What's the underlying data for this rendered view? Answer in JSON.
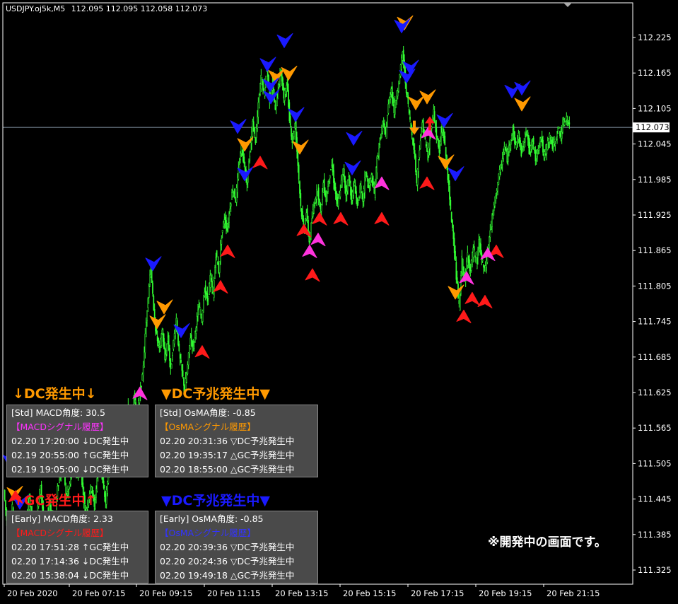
{
  "chart_data": {
    "type": "candlestick",
    "title": "USDJPY.oj5k,M5  112.095 112.095 112.058 112.073",
    "symbol": "USDJPY.oj5k,M5",
    "ohlc_header": "112.095 112.095 112.058 112.073",
    "last_price": "112.073",
    "ylim": [
      111.29,
      112.27
    ],
    "y_ticks": [
      "112.225",
      "112.165",
      "112.105",
      "112.045",
      "111.985",
      "111.925",
      "111.865",
      "111.805",
      "111.745",
      "111.685",
      "111.625",
      "111.565",
      "111.505",
      "111.445",
      "111.385",
      "111.325"
    ],
    "x_ticks": [
      "20 Feb 2020",
      "20 Feb 07:15",
      "20 Feb 09:15",
      "20 Feb 11:15",
      "20 Feb 13:15",
      "20 Feb 15:15",
      "20 Feb 17:15",
      "20 Feb 19:15",
      "20 Feb 21:15"
    ],
    "close_path": [
      [
        0,
        111.46
      ],
      [
        4,
        111.41
      ],
      [
        8,
        111.38
      ],
      [
        12,
        111.43
      ],
      [
        16,
        111.4
      ],
      [
        20,
        111.37
      ],
      [
        24,
        111.36
      ],
      [
        28,
        111.42
      ],
      [
        32,
        111.4
      ],
      [
        36,
        111.45
      ],
      [
        40,
        111.41
      ],
      [
        44,
        111.38
      ],
      [
        48,
        111.43
      ],
      [
        52,
        111.47
      ],
      [
        56,
        111.41
      ],
      [
        60,
        111.39
      ],
      [
        64,
        111.44
      ],
      [
        68,
        111.42
      ],
      [
        72,
        111.4
      ],
      [
        76,
        111.47
      ],
      [
        80,
        111.48
      ],
      [
        84,
        111.51
      ],
      [
        88,
        111.45
      ],
      [
        92,
        111.46
      ],
      [
        96,
        111.49
      ],
      [
        100,
        111.52
      ],
      [
        104,
        111.48
      ],
      [
        108,
        111.5
      ],
      [
        112,
        111.46
      ],
      [
        116,
        111.42
      ],
      [
        120,
        111.45
      ],
      [
        124,
        111.47
      ],
      [
        128,
        111.43
      ],
      [
        132,
        111.48
      ],
      [
        136,
        111.52
      ],
      [
        140,
        111.47
      ],
      [
        144,
        111.44
      ],
      [
        148,
        111.49
      ],
      [
        152,
        111.53
      ],
      [
        156,
        111.5
      ],
      [
        160,
        111.55
      ],
      [
        164,
        111.52
      ],
      [
        168,
        111.57
      ],
      [
        172,
        111.54
      ],
      [
        176,
        111.6
      ],
      [
        180,
        111.57
      ],
      [
        184,
        111.62
      ],
      [
        188,
        111.58
      ],
      [
        192,
        111.62
      ],
      [
        196,
        111.65
      ],
      [
        200,
        111.72
      ],
      [
        204,
        111.79
      ],
      [
        208,
        111.84
      ],
      [
        212,
        111.76
      ],
      [
        216,
        111.72
      ],
      [
        220,
        111.7
      ],
      [
        224,
        111.73
      ],
      [
        228,
        111.68
      ],
      [
        232,
        111.72
      ],
      [
        236,
        111.66
      ],
      [
        240,
        111.71
      ],
      [
        244,
        111.75
      ],
      [
        248,
        111.69
      ],
      [
        252,
        111.66
      ],
      [
        256,
        111.63
      ],
      [
        260,
        111.67
      ],
      [
        264,
        111.72
      ],
      [
        268,
        111.7
      ],
      [
        272,
        111.74
      ],
      [
        276,
        111.77
      ],
      [
        280,
        111.75
      ],
      [
        284,
        111.8
      ],
      [
        288,
        111.78
      ],
      [
        292,
        111.82
      ],
      [
        296,
        111.79
      ],
      [
        300,
        111.86
      ],
      [
        304,
        111.83
      ],
      [
        308,
        111.89
      ],
      [
        312,
        111.92
      ],
      [
        316,
        111.9
      ],
      [
        320,
        111.94
      ],
      [
        324,
        111.97
      ],
      [
        328,
        111.95
      ],
      [
        332,
        112.0
      ],
      [
        336,
        112.04
      ],
      [
        340,
        112.01
      ],
      [
        344,
        111.98
      ],
      [
        348,
        112.03
      ],
      [
        352,
        112.08
      ],
      [
        356,
        112.05
      ],
      [
        360,
        112.11
      ],
      [
        364,
        112.16
      ],
      [
        368,
        112.13
      ],
      [
        372,
        112.18
      ],
      [
        376,
        112.12
      ],
      [
        380,
        112.15
      ],
      [
        384,
        112.1
      ],
      [
        388,
        112.14
      ],
      [
        392,
        112.17
      ],
      [
        396,
        112.12
      ],
      [
        400,
        112.15
      ],
      [
        404,
        112.09
      ],
      [
        408,
        112.05
      ],
      [
        412,
        112.08
      ],
      [
        416,
        112.01
      ],
      [
        420,
        111.94
      ],
      [
        424,
        111.9
      ],
      [
        428,
        111.93
      ],
      [
        432,
        111.88
      ],
      [
        436,
        111.92
      ],
      [
        440,
        111.95
      ],
      [
        444,
        111.97
      ],
      [
        448,
        111.93
      ],
      [
        452,
        111.98
      ],
      [
        456,
        111.95
      ],
      [
        460,
        111.99
      ],
      [
        464,
        112.01
      ],
      [
        468,
        111.97
      ],
      [
        472,
        111.94
      ],
      [
        476,
        111.97
      ],
      [
        480,
        112.0
      ],
      [
        484,
        111.96
      ],
      [
        488,
        111.99
      ],
      [
        492,
        111.95
      ],
      [
        496,
        111.98
      ],
      [
        500,
        111.94
      ],
      [
        504,
        111.97
      ],
      [
        508,
        111.95
      ],
      [
        512,
        112.0
      ],
      [
        516,
        111.97
      ],
      [
        520,
        111.99
      ],
      [
        524,
        111.96
      ],
      [
        528,
        112.02
      ],
      [
        532,
        112.05
      ],
      [
        536,
        112.08
      ],
      [
        540,
        112.06
      ],
      [
        544,
        112.11
      ],
      [
        548,
        112.14
      ],
      [
        552,
        112.1
      ],
      [
        556,
        112.13
      ],
      [
        560,
        112.16
      ],
      [
        564,
        112.2
      ],
      [
        568,
        112.15
      ],
      [
        572,
        112.11
      ],
      [
        576,
        112.07
      ],
      [
        580,
        112.04
      ],
      [
        584,
        111.98
      ],
      [
        588,
        112.04
      ],
      [
        592,
        112.08
      ],
      [
        596,
        112.05
      ],
      [
        600,
        112.02
      ],
      [
        604,
        112.07
      ],
      [
        608,
        112.1
      ],
      [
        612,
        112.06
      ],
      [
        616,
        112.03
      ],
      [
        620,
        112.08
      ],
      [
        624,
        112.04
      ],
      [
        628,
        111.99
      ],
      [
        632,
        111.93
      ],
      [
        636,
        111.89
      ],
      [
        640,
        111.82
      ],
      [
        644,
        111.77
      ],
      [
        648,
        111.85
      ],
      [
        652,
        111.81
      ],
      [
        656,
        111.86
      ],
      [
        660,
        111.83
      ],
      [
        664,
        111.87
      ],
      [
        668,
        111.84
      ],
      [
        672,
        111.88
      ],
      [
        676,
        111.85
      ],
      [
        680,
        111.83
      ],
      [
        684,
        111.86
      ],
      [
        688,
        111.9
      ],
      [
        692,
        111.93
      ],
      [
        696,
        111.96
      ],
      [
        700,
        111.99
      ],
      [
        704,
        112.01
      ],
      [
        708,
        112.04
      ],
      [
        712,
        112.02
      ],
      [
        716,
        112.05
      ],
      [
        720,
        112.07
      ],
      [
        724,
        112.04
      ],
      [
        728,
        112.06
      ],
      [
        732,
        112.03
      ],
      [
        736,
        112.05
      ],
      [
        740,
        112.07
      ],
      [
        744,
        112.03
      ],
      [
        748,
        112.05
      ],
      [
        752,
        112.02
      ],
      [
        756,
        112.04
      ],
      [
        760,
        112.06
      ],
      [
        764,
        112.02
      ],
      [
        768,
        112.04
      ],
      [
        772,
        112.06
      ],
      [
        776,
        112.04
      ],
      [
        780,
        112.05
      ],
      [
        784,
        112.07
      ],
      [
        788,
        112.06
      ],
      [
        792,
        112.08
      ],
      [
        796,
        112.09
      ],
      [
        800,
        112.073
      ]
    ],
    "signal_arrows": [
      {
        "x": 572,
        "p": 112.245,
        "dir": "down",
        "color": "#ff9900"
      },
      {
        "x": 568,
        "p": 112.24,
        "dir": "down",
        "color": "#1a1aff"
      },
      {
        "x": 402,
        "p": 112.215,
        "dir": "down",
        "color": "#1a1aff"
      },
      {
        "x": 378,
        "p": 112.175,
        "dir": "down",
        "color": "#1a1aff"
      },
      {
        "x": 408,
        "p": 112.16,
        "dir": "down",
        "color": "#ff9900"
      },
      {
        "x": 390,
        "p": 112.155,
        "dir": "down",
        "color": "#ff9900"
      },
      {
        "x": 382,
        "p": 112.14,
        "dir": "down",
        "color": "#1a1aff"
      },
      {
        "x": 383,
        "p": 112.12,
        "dir": "down",
        "color": "#1a1aff"
      },
      {
        "x": 580,
        "p": 112.17,
        "dir": "down",
        "color": "#1a1aff"
      },
      {
        "x": 575,
        "p": 112.155,
        "dir": "down",
        "color": "#1a1aff"
      },
      {
        "x": 588,
        "p": 112.11,
        "dir": "down",
        "color": "#ff9900"
      },
      {
        "x": 604,
        "p": 112.12,
        "dir": "down",
        "color": "#ff9900"
      },
      {
        "x": 738,
        "p": 112.135,
        "dir": "down",
        "color": "#1a1aff"
      },
      {
        "x": 724,
        "p": 112.13,
        "dir": "down",
        "color": "#1a1aff"
      },
      {
        "x": 738,
        "p": 112.108,
        "dir": "down",
        "color": "#ff9900"
      },
      {
        "x": 418,
        "p": 112.09,
        "dir": "down",
        "color": "#1a1aff"
      },
      {
        "x": 628,
        "p": 112.08,
        "dir": "down",
        "color": "#1a1aff"
      },
      {
        "x": 336,
        "p": 112.07,
        "dir": "down",
        "color": "#1a1aff"
      },
      {
        "x": 500,
        "p": 112.05,
        "dir": "down",
        "color": "#1a1aff"
      },
      {
        "x": 346,
        "p": 112.04,
        "dir": "down",
        "color": "#ff9900"
      },
      {
        "x": 424,
        "p": 112.035,
        "dir": "down",
        "color": "#ff9900"
      },
      {
        "x": 630,
        "p": 112.01,
        "dir": "down",
        "color": "#ff9900"
      },
      {
        "x": 498,
        "p": 112.0,
        "dir": "down",
        "color": "#1a1aff"
      },
      {
        "x": 644,
        "p": 111.99,
        "dir": "down",
        "color": "#1a1aff"
      },
      {
        "x": 346,
        "p": 111.99,
        "dir": "down",
        "color": "#1a1aff"
      },
      {
        "x": 216,
        "p": 111.838,
        "dir": "down",
        "color": "#1a1aff"
      },
      {
        "x": 232,
        "p": 111.765,
        "dir": "down",
        "color": "#ff9900"
      },
      {
        "x": 222,
        "p": 111.74,
        "dir": "down",
        "color": "#ff9900"
      },
      {
        "x": 256,
        "p": 111.725,
        "dir": "down",
        "color": "#1a1aff"
      },
      {
        "x": 644,
        "p": 111.79,
        "dir": "down",
        "color": "#ff9900"
      },
      {
        "x": 20,
        "p": 111.45,
        "dir": "down",
        "color": "#ff9900"
      },
      {
        "x": 14,
        "p": 111.505,
        "dir": "down",
        "color": "#1a1aff"
      },
      {
        "x": 28,
        "p": 111.435,
        "dir": "down",
        "color": "#1a1aff"
      },
      {
        "x": 20,
        "p": 111.38,
        "dir": "down",
        "color": "#1a1aff"
      },
      {
        "x": 368,
        "p": 112.01,
        "dir": "up",
        "color": "#ff1a1a"
      },
      {
        "x": 540,
        "p": 111.915,
        "dir": "up",
        "color": "#ff1a1a"
      },
      {
        "x": 540,
        "p": 111.975,
        "dir": "up",
        "color": "#ff33dd"
      },
      {
        "x": 604,
        "p": 111.975,
        "dir": "up",
        "color": "#ff1a1a"
      },
      {
        "x": 482,
        "p": 111.915,
        "dir": "up",
        "color": "#ff1a1a"
      },
      {
        "x": 452,
        "p": 111.915,
        "dir": "up",
        "color": "#ff1a1a"
      },
      {
        "x": 430,
        "p": 111.895,
        "dir": "up",
        "color": "#ff1a1a"
      },
      {
        "x": 450,
        "p": 111.88,
        "dir": "up",
        "color": "#ff33dd"
      },
      {
        "x": 438,
        "p": 111.86,
        "dir": "up",
        "color": "#ff33dd"
      },
      {
        "x": 442,
        "p": 111.82,
        "dir": "up",
        "color": "#ff1a1a"
      },
      {
        "x": 322,
        "p": 111.86,
        "dir": "up",
        "color": "#ff1a1a"
      },
      {
        "x": 312,
        "p": 111.8,
        "dir": "up",
        "color": "#ff1a1a"
      },
      {
        "x": 286,
        "p": 111.69,
        "dir": "up",
        "color": "#ff1a1a"
      },
      {
        "x": 198,
        "p": 111.62,
        "dir": "up",
        "color": "#ff33dd"
      },
      {
        "x": 196,
        "p": 111.495,
        "dir": "up",
        "color": "#ff1a1a"
      },
      {
        "x": 606,
        "p": 112.06,
        "dir": "up",
        "color": "#ff33dd"
      },
      {
        "x": 702,
        "p": 111.86,
        "dir": "up",
        "color": "#ff1a1a"
      },
      {
        "x": 690,
        "p": 111.855,
        "dir": "up",
        "color": "#ff33dd"
      },
      {
        "x": 660,
        "p": 111.815,
        "dir": "up",
        "color": "#ff33dd"
      },
      {
        "x": 686,
        "p": 111.775,
        "dir": "up",
        "color": "#ff1a1a"
      },
      {
        "x": 668,
        "p": 111.78,
        "dir": "up",
        "color": "#ff1a1a"
      },
      {
        "x": 656,
        "p": 111.75,
        "dir": "up",
        "color": "#ff1a1a"
      },
      {
        "x": 22,
        "p": 111.445,
        "dir": "up",
        "color": "#ff1a1a"
      }
    ],
    "block_arrows": [
      {
        "x": 586,
        "p": 112.07,
        "dir": "down",
        "color": "#ff9900"
      },
      {
        "x": 608,
        "p": 112.08,
        "dir": "up",
        "color": "#ff1a1a"
      }
    ]
  },
  "overlays": {
    "dc_heading": "↓DC発生中↓",
    "gc_heading": "↑GC発生中↑",
    "osma_dc_sign_heading": "▼DC予兆発生中▼",
    "osma_dc_sign_heading2": "▼DC予兆発生中▼",
    "panels": {
      "std_macd": {
        "lines": [
          "[Std] MACD角度: 30.5",
          "【MACDシグナル履歴】",
          "02.20 17:20:00 ↓DC発生中",
          "02.19 20:55:00 ↑GC発生中",
          "02.19 19:05:00 ↓DC発生中"
        ],
        "colors": [
          "#ffffff",
          "#ff33ff",
          "#ffffff",
          "#ffffff",
          "#ffffff"
        ]
      },
      "std_osma": {
        "lines": [
          "[Std] OsMA角度: -0.85",
          "【OsMAシグナル履歴】",
          "02.20 20:31:36 ▽DC予兆発生中",
          "02.20 19:35:17 △GC予兆発生中",
          "02.20 18:55:00 △GC予兆発生中"
        ],
        "colors": [
          "#ffffff",
          "#ff9900",
          "#ffffff",
          "#ffffff",
          "#ffffff"
        ]
      },
      "early_macd": {
        "lines": [
          "[Early] MACD角度: 2.33",
          "【MACDシグナル履歴】",
          "02.20 17:51:28 ↑GC発生中",
          "02.20 17:14:36 ↓DC発生中",
          "02.20 15:38:04 ↓DC発生中"
        ],
        "colors": [
          "#ffffff",
          "#ff1a1a",
          "#ffffff",
          "#ffffff",
          "#ffffff"
        ]
      },
      "early_osma": {
        "lines": [
          "[Early] OsMA角度: -0.85",
          "【OsMAシグナル履歴】",
          "02.20 20:39:36 ▽DC予兆発生中",
          "02.20 20:24:36 ▽DC予兆発生中",
          "02.20 19:49:18 △GC予兆発生中"
        ],
        "colors": [
          "#ffffff",
          "#3333ff",
          "#ffffff",
          "#ffffff",
          "#ffffff"
        ]
      }
    },
    "note": "※開発中の画面です。"
  },
  "colors": {
    "bull": "#33ff33",
    "bear": "#33ff33",
    "axis": "#ffffff",
    "price_line": "#8899aa",
    "dc_heading": "#ff9900",
    "gc_heading": "#ff1a1a",
    "osma_heading": "#ff9900",
    "osma_heading2": "#1a1aff"
  }
}
